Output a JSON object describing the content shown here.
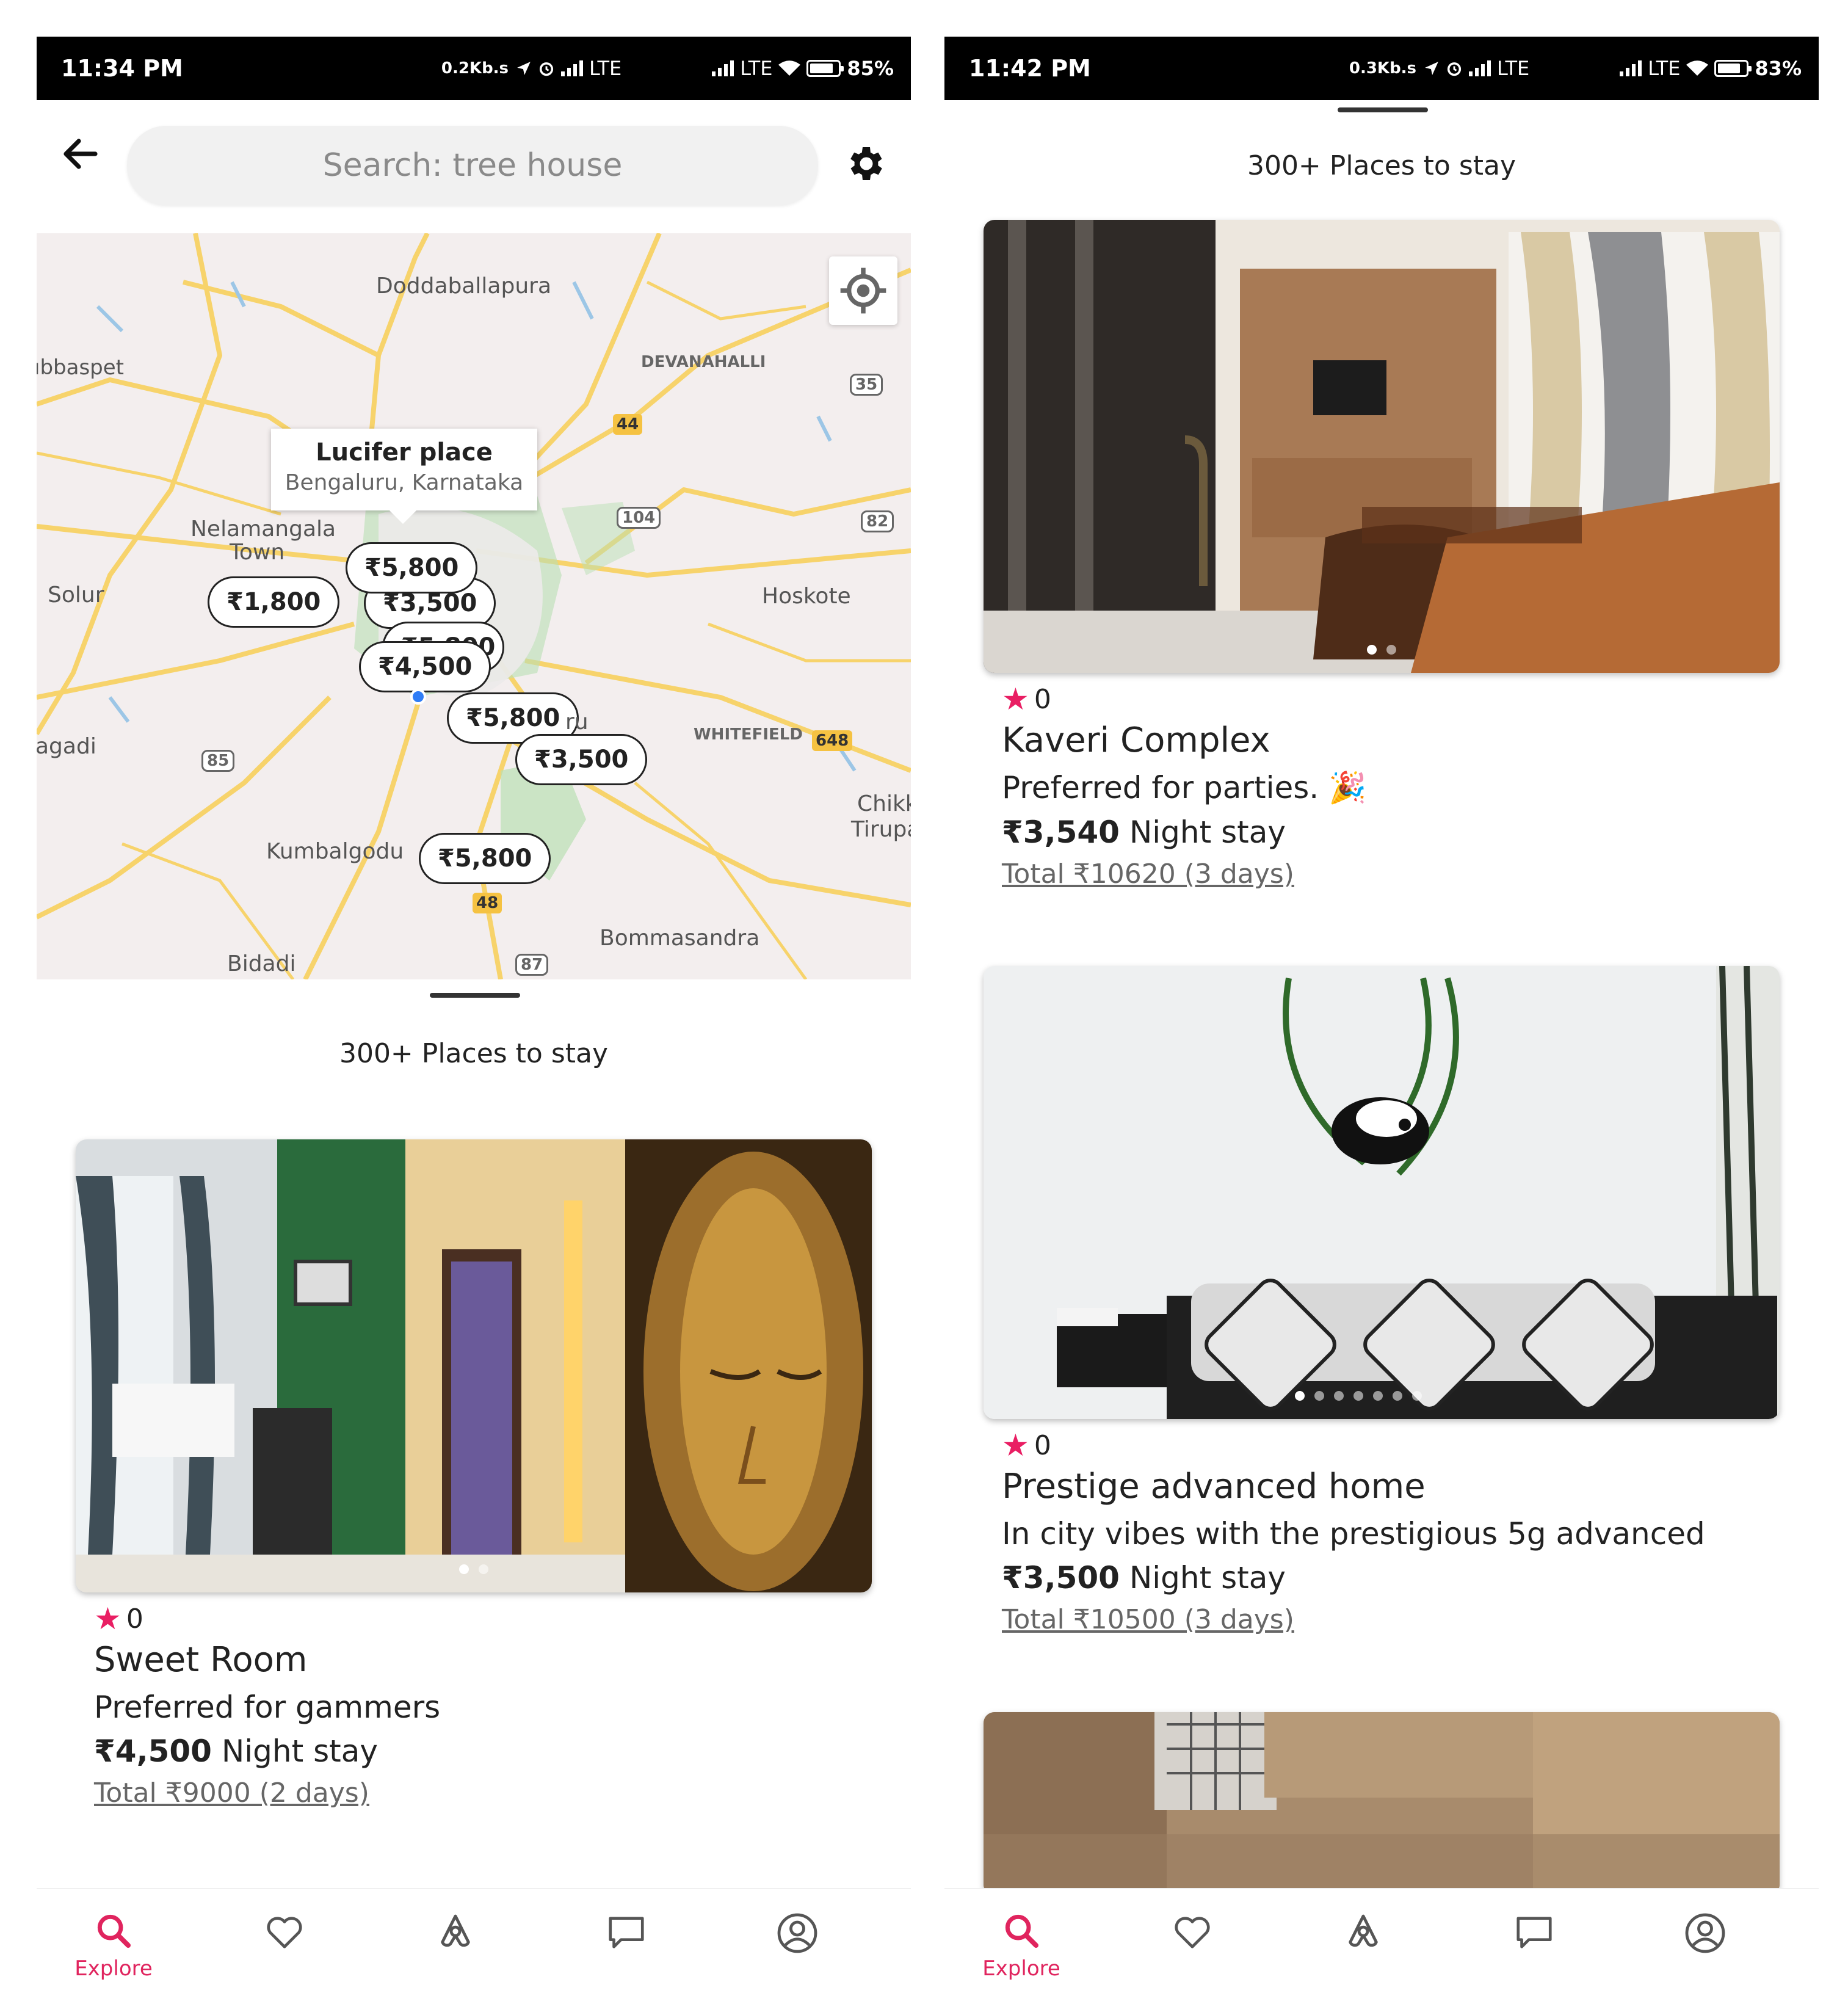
{
  "colors": {
    "accent": "#e0245e",
    "star": "#e91e63",
    "map_bg": "#f3eeee",
    "road": "#f7d36b",
    "park": "#b9dfb4"
  },
  "left": {
    "status": {
      "time": "11:34 PM",
      "speed": "0.2Kb.s",
      "lte1": "LTE",
      "lte2": "LTE",
      "battery": "85%",
      "battery_level": 0.85
    },
    "search": {
      "placeholder": "Search: tree house"
    },
    "map": {
      "places": [
        "Doddaballapura",
        "DEVANAHALLI",
        "ıbbaspet",
        "Nelamangala",
        "Town",
        "Solur",
        "Hoskote",
        "WHITEFIELD",
        "agadi",
        "Kumbalgodu",
        "Bommasandra",
        "Bidadi",
        "Chikk",
        "Tirupa",
        "ru"
      ],
      "road_badges": [
        "35",
        "44",
        "104",
        "82",
        "648",
        "85",
        "48",
        "87"
      ],
      "info": {
        "title": "Lucifer place",
        "subtitle": "Bengaluru, Karnataka"
      },
      "pins": [
        "₹5,800",
        "₹1,800",
        "₹3,500",
        "₹4,500",
        "₹5,800",
        "₹3,500",
        "₹5,800"
      ]
    },
    "heading": "300+ Places to stay",
    "card": {
      "rating": "0",
      "title": "Sweet Room",
      "desc": "Preferred for gammers",
      "price": "₹4,500",
      "price_suffix": " Night stay",
      "total": "Total ₹9000 (2 days)"
    },
    "nav": {
      "explore": "Explore"
    }
  },
  "right": {
    "status": {
      "time": "11:42 PM",
      "speed": "0.3Kb.s",
      "lte1": "LTE",
      "lte2": "LTE",
      "battery": "83%",
      "battery_level": 0.83
    },
    "heading": "300+ Places to stay",
    "cards": [
      {
        "rating": "0",
        "title": "Kaveri Complex",
        "desc": "Preferred for parties. 🎉",
        "price": "₹3,540",
        "price_suffix": " Night stay",
        "total": "Total ₹10620 (3 days)"
      },
      {
        "rating": "0",
        "title": "Prestige advanced home",
        "desc": "In city vibes with the prestigious 5g advanced",
        "price": "₹3,500",
        "price_suffix": " Night stay",
        "total": "Total ₹10500 (3 days)"
      }
    ],
    "nav": {
      "explore": "Explore"
    }
  }
}
